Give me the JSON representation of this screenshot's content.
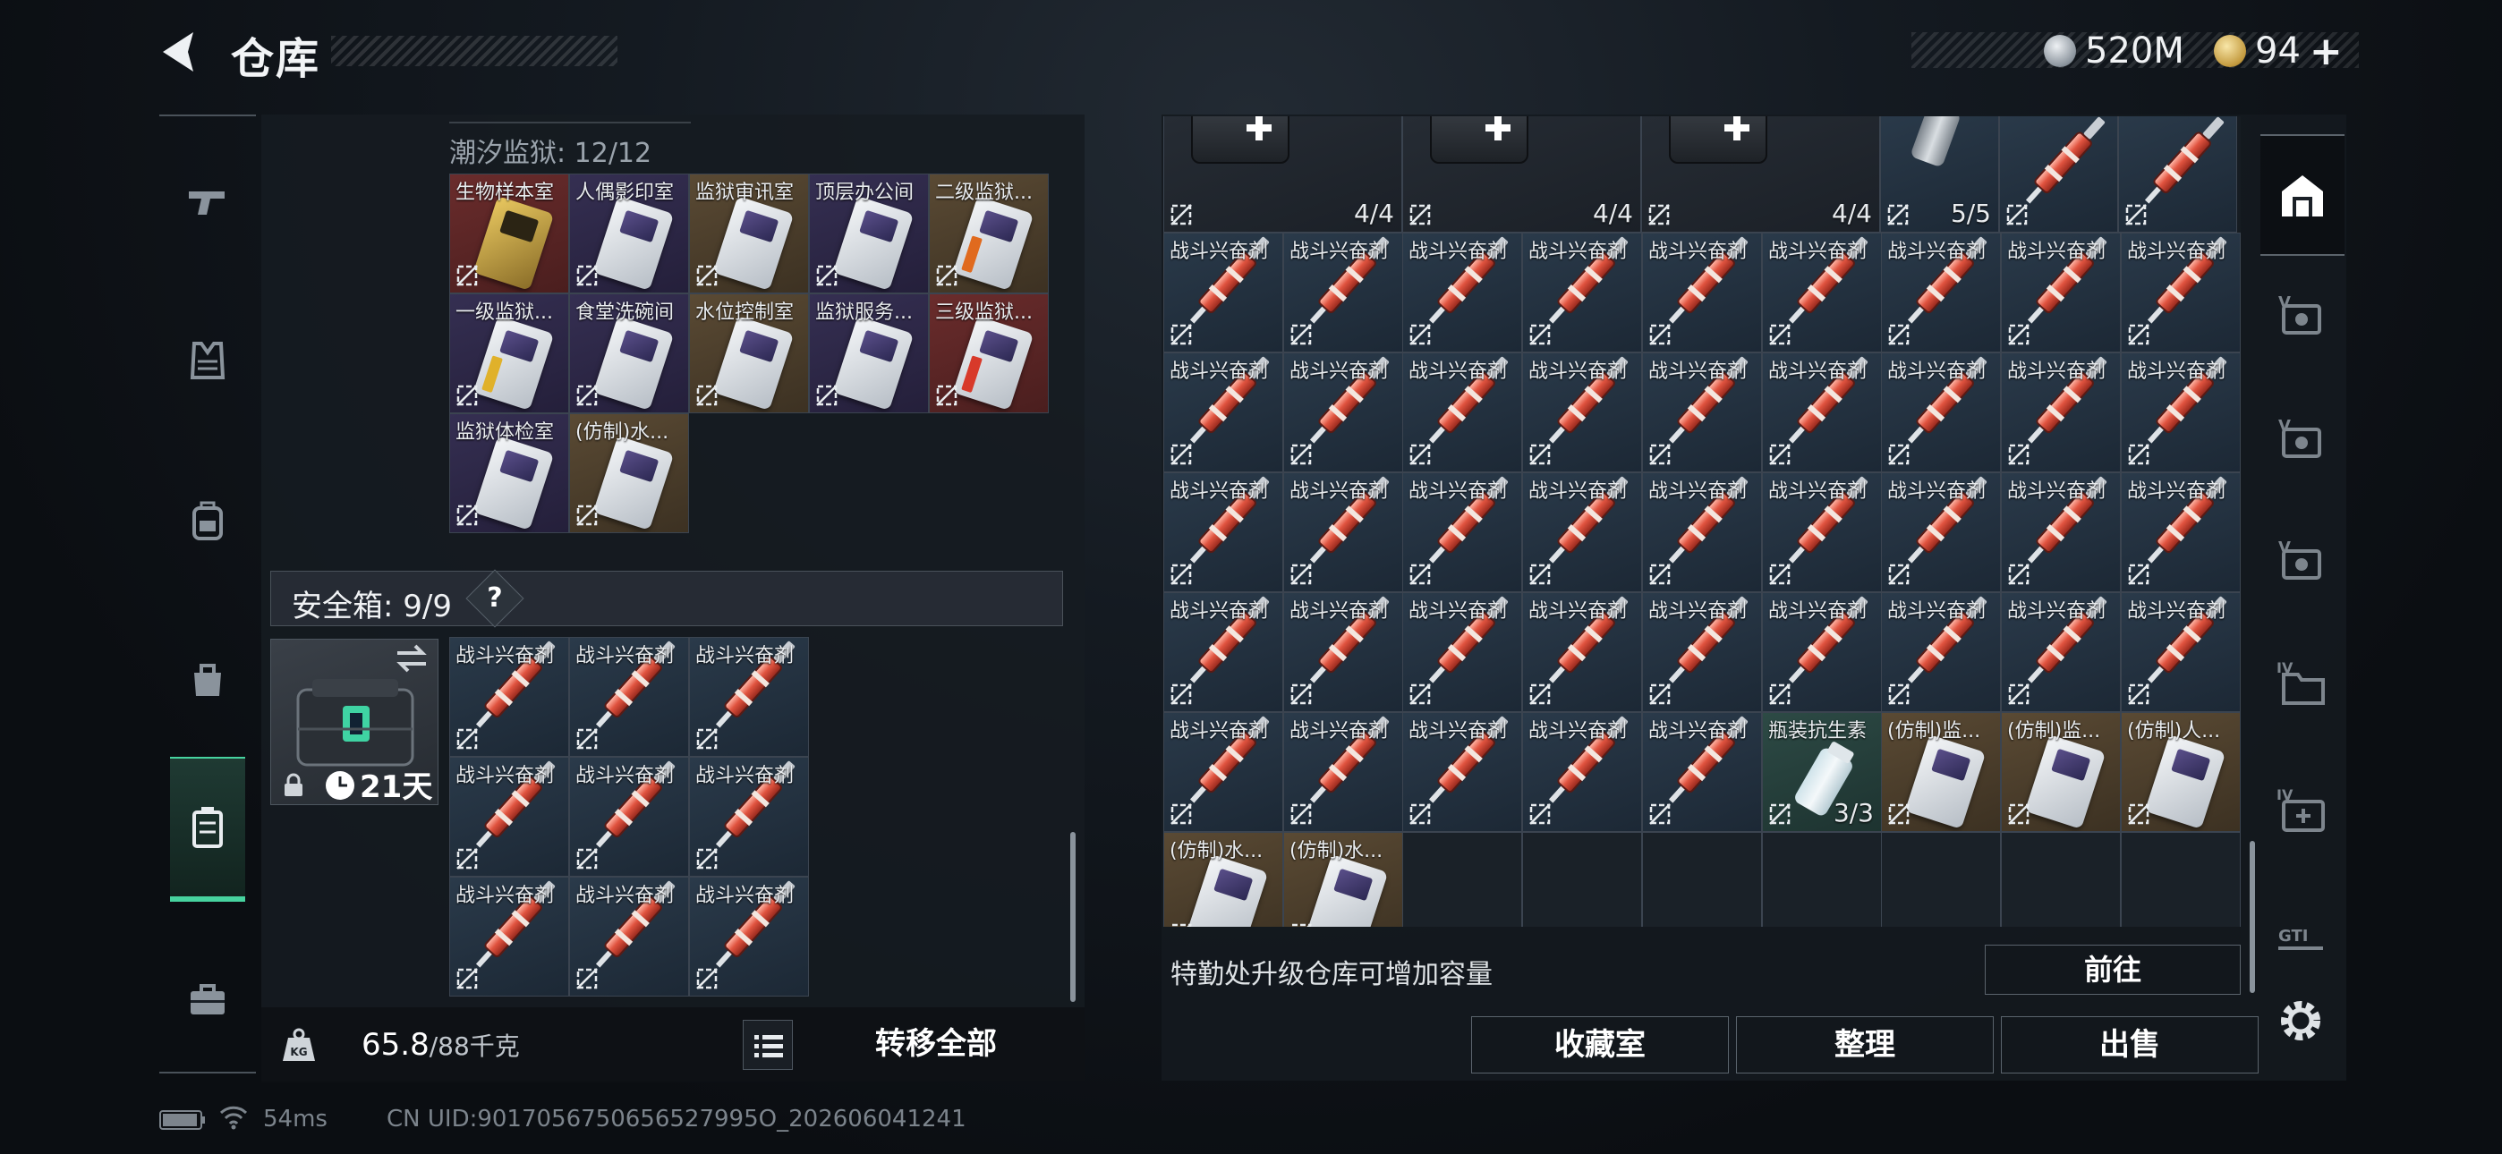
{
  "header": {
    "title": "仓库",
    "currency_silver": "520M",
    "currency_gold": "94",
    "plus_label": "+",
    "version_tag": "..."
  },
  "left": {
    "prison_label": "潮汐监狱: 12/12",
    "prison_items": [
      {
        "name": "生物样本室",
        "bg": "red",
        "card": "gold",
        "stripe": ""
      },
      {
        "name": "人偶影印室",
        "bg": "purple",
        "card": "white",
        "stripe": ""
      },
      {
        "name": "监狱审讯室",
        "bg": "gold",
        "card": "white",
        "stripe": ""
      },
      {
        "name": "顶层办公间",
        "bg": "purple",
        "card": "white",
        "stripe": ""
      },
      {
        "name": "二级监狱...",
        "bg": "gold",
        "card": "white",
        "stripe": "ostripe"
      },
      {
        "name": "一级监狱...",
        "bg": "purple",
        "card": "white",
        "stripe": "ystripe"
      },
      {
        "name": "食堂洗碗间",
        "bg": "purple",
        "card": "white",
        "stripe": ""
      },
      {
        "name": "水位控制室",
        "bg": "gold",
        "card": "white",
        "stripe": ""
      },
      {
        "name": "监狱服务...",
        "bg": "purple",
        "card": "white",
        "stripe": ""
      },
      {
        "name": "三级监狱...",
        "bg": "red",
        "card": "white",
        "stripe": "rstripe"
      },
      {
        "name": "监狱体检室",
        "bg": "purple",
        "card": "white",
        "stripe": ""
      },
      {
        "name": "(仿制)水...",
        "bg": "gold",
        "card": "white",
        "stripe": ""
      }
    ],
    "safebox_label": "安全箱: 9/9",
    "help_label": "?",
    "case_duration": "21天",
    "safebox_items": [
      "战斗兴奋剂",
      "战斗兴奋剂",
      "战斗兴奋剂",
      "战斗兴奋剂",
      "战斗兴奋剂",
      "战斗兴奋剂",
      "战斗兴奋剂",
      "战斗兴奋剂",
      "战斗兴奋剂"
    ],
    "weight_current": "65.8",
    "weight_max": "/88千克",
    "transfer_all": "转移全部"
  },
  "right": {
    "top_row": [
      {
        "name": "",
        "type": "medkit",
        "count": "4/4"
      },
      {
        "name": "",
        "type": "medkit",
        "count": "4/4"
      },
      {
        "name": "",
        "type": "medkit",
        "count": "4/4"
      },
      {
        "name": "",
        "type": "canister",
        "count": "5/5"
      },
      {
        "name": "",
        "type": "syringe",
        "count": ""
      },
      {
        "name": "",
        "type": "syringe",
        "count": ""
      }
    ],
    "stim_name": "战斗兴奋剂",
    "row5_extra": [
      {
        "name": "瓶装抗生素",
        "type": "bottle",
        "count": "3/3"
      },
      {
        "name": "(仿制)监...",
        "type": "card",
        "count": ""
      },
      {
        "name": "(仿制)监...",
        "type": "card",
        "count": ""
      },
      {
        "name": "(仿制)人...",
        "type": "card",
        "count": ""
      }
    ],
    "row6": [
      {
        "name": "(仿制)水...",
        "type": "card",
        "count": ""
      },
      {
        "name": "(仿制)水...",
        "type": "card",
        "count": ""
      }
    ],
    "upgrade_hint": "特勤处升级仓库可增加容量",
    "goto": "前往",
    "collection": "收藏室",
    "organize": "整理",
    "sell": "出售"
  },
  "status": {
    "ping": "54ms",
    "uid": "CN UID:9017056750656527995O_202606041241"
  },
  "icons": {
    "left_nav": [
      "pistol-icon",
      "armor-vest-icon",
      "backpack-icon",
      "bag-icon",
      "storage-case-icon",
      "briefcase-icon"
    ],
    "right_nav": [
      "warehouse-icon",
      "v-storage-1-icon",
      "v-storage-2-icon",
      "v-storage-3-icon",
      "iv-folder-icon",
      "iv-medical-icon",
      "gti-icon"
    ]
  },
  "colors": {
    "accent": "#47d39f",
    "stim_red": "#e0533f"
  }
}
